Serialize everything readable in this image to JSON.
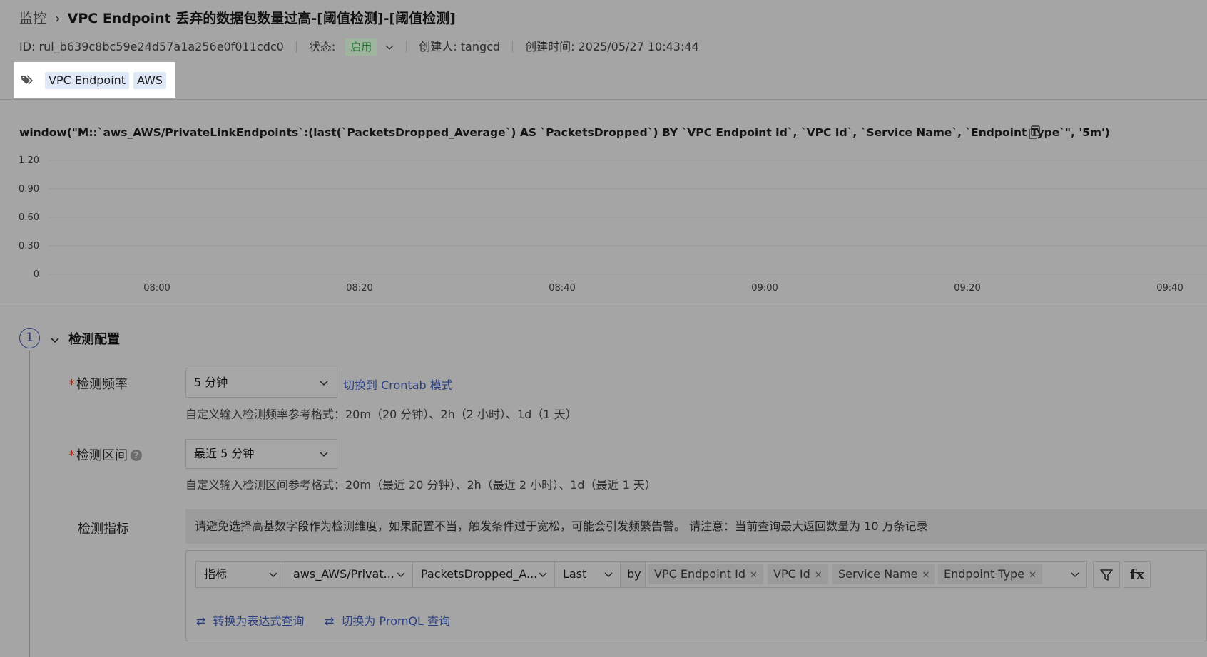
{
  "breadcrumb": {
    "root": "监控",
    "separator": "›",
    "title": "VPC Endpoint 丢弃的数据包数量过高-[阈值检测]-[阈值检测]"
  },
  "meta": {
    "id": "ID: rul_b639c8bc59e24d57a1a256e0f011cdc0",
    "status_label": "状态:",
    "status_value": "启用",
    "creator": "创建人: tangcd",
    "created_time": "创建时间: 2025/05/27 10:43:44"
  },
  "tags": [
    "VPC Endpoint",
    "AWS"
  ],
  "query_text": "window(\"M::`aws_AWS/PrivateLinkEndpoints`:(last(`PacketsDropped_Average`) AS `PacketsDropped`) BY `VPC Endpoint Id`, `VPC Id`, `Service Name`, `Endpoint Type`\", '5m')",
  "chart_data": {
    "type": "line",
    "title": "",
    "xlabel": "",
    "ylabel": "",
    "x_ticks": [
      "08:00",
      "08:20",
      "08:40",
      "09:00",
      "09:20",
      "09:40"
    ],
    "y_ticks": [
      "1.20",
      "0.90",
      "0.60",
      "0.30",
      "0"
    ],
    "ylim": [
      0,
      1.2
    ],
    "grid": true,
    "series": []
  },
  "config": {
    "step_number": "1",
    "section_title": "检测配置",
    "frequency": {
      "required_mark": "*",
      "label": "检测频率",
      "value": "5 分钟",
      "switch_link": "切换到 Crontab 模式",
      "hint": "自定义输入检测频率参考格式：20m（20 分钟）、2h（2 小时）、1d（1 天）"
    },
    "interval": {
      "required_mark": "*",
      "label": "检测区间",
      "value": "最近 5 分钟",
      "hint": "自定义输入检测区间参考格式：20m（最近 20 分钟）、2h（最近 2 小时）、1d（最近 1 天）"
    },
    "metric": {
      "label": "检测指标",
      "warning": "请避免选择高基数字段作为检测维度，如果配置不当，触发条件过于宽松，可能会引发频繁告警。 请注意：当前查询最大返回数量为 10 万条记录",
      "query_type": "指标",
      "measurement": "aws_AWS/Privat...",
      "field": "PacketsDropped_A...",
      "aggregation": "Last",
      "by_label": "by",
      "group_by": [
        "VPC Endpoint Id",
        "VPC Id",
        "Service Name",
        "Endpoint Type"
      ],
      "fx_label": "fx",
      "convert_expression": "转换为表达式查询",
      "convert_promql": "切换为 PromQL 查询"
    }
  },
  "colors": {
    "background": "#a5a5a5",
    "link": "#2a3f82",
    "status_green": "#1f6b2a",
    "required": "#a2331f"
  }
}
